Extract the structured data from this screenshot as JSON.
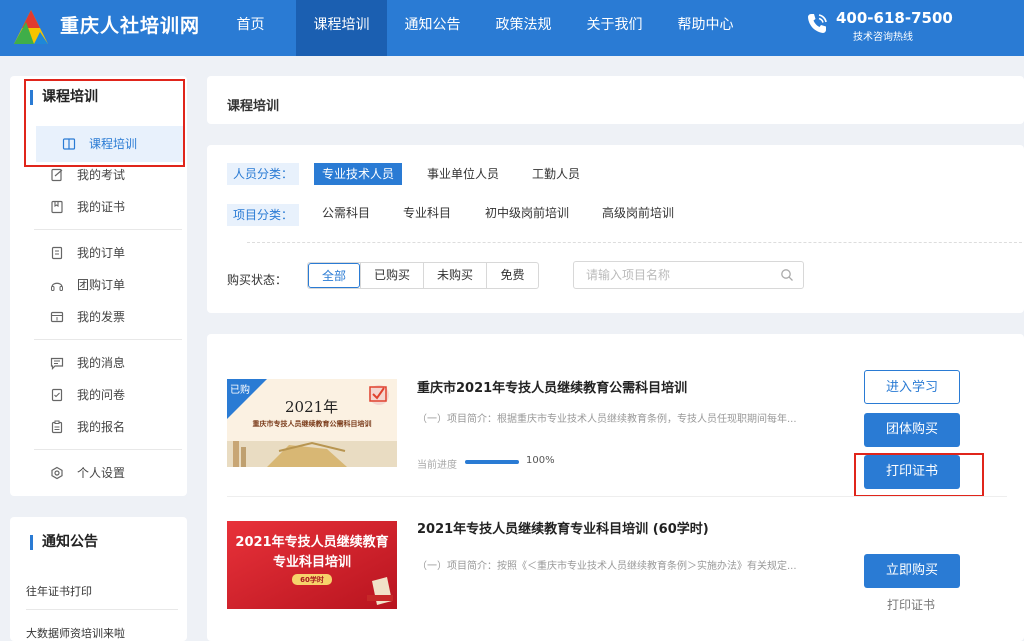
{
  "header": {
    "site_name": "重庆人社培训网",
    "nav": [
      "首页",
      "课程培训",
      "通知公告",
      "政策法规",
      "关于我们",
      "帮助中心"
    ],
    "active_nav": 1,
    "hotline_number": "400-618-7500",
    "hotline_label": "技术咨询热线",
    "accent_color": "#2a7bd4"
  },
  "sidebar": {
    "title": "课程培训",
    "items": [
      {
        "label": "课程培训",
        "icon": "book-icon"
      },
      {
        "label": "我的考试",
        "icon": "exam-icon"
      },
      {
        "label": "我的证书",
        "icon": "bookmark-icon"
      },
      {
        "label": "我的订单",
        "icon": "order-icon"
      },
      {
        "label": "团购订单",
        "icon": "headset-icon"
      },
      {
        "label": "我的发票",
        "icon": "invoice-icon"
      },
      {
        "label": "我的消息",
        "icon": "message-icon"
      },
      {
        "label": "我的问卷",
        "icon": "survey-icon"
      },
      {
        "label": "我的报名",
        "icon": "clipboard-icon"
      },
      {
        "label": "个人设置",
        "icon": "settings-icon"
      }
    ],
    "notice_title": "通知公告",
    "notices": [
      "往年证书打印",
      "大数据师资培训来啦"
    ]
  },
  "main": {
    "breadcrumb": "课程培训",
    "filters": {
      "person_label": "人员分类：",
      "person_options": [
        "专业技术人员",
        "事业单位人员",
        "工勤人员"
      ],
      "person_selected": 0,
      "project_label": "项目分类：",
      "project_options": [
        "公需科目",
        "专业科目",
        "初中级岗前培训",
        "高级岗前培训"
      ],
      "status_label": "购买状态：",
      "status_options": [
        "全部",
        "已购买",
        "未购买",
        "免费"
      ],
      "status_selected": 0,
      "search_placeholder": "请输入项目名称"
    },
    "courses": [
      {
        "title": "重庆市2021年专技人员继续教育公需科目培训",
        "desc": "（一）项目简介：根据重庆市专业技术人员继续教育条例，专技人员任现职期间每年...",
        "badge": "已购",
        "thumb_year": "2021年",
        "thumb_subtitle": "重庆市专技人员继续教育公需科目培训",
        "progress_label": "当前进度",
        "progress": 100,
        "progress_text": "100%",
        "buttons": [
          "进入学习",
          "团体购买",
          "打印证书"
        ]
      },
      {
        "title": "2021年专技人员继续教育专业科目培训 (60学时)",
        "desc": "（一）项目简介：按照《＜重庆市专业技术人员继续教育条例＞实施办法》有关规定...",
        "thumb_line1": "2021年专技人员继续教育",
        "thumb_line2": "专业科目培训",
        "thumb_hours": "60学时",
        "buttons": [
          "立即购买"
        ],
        "link": "打印证书"
      }
    ]
  }
}
